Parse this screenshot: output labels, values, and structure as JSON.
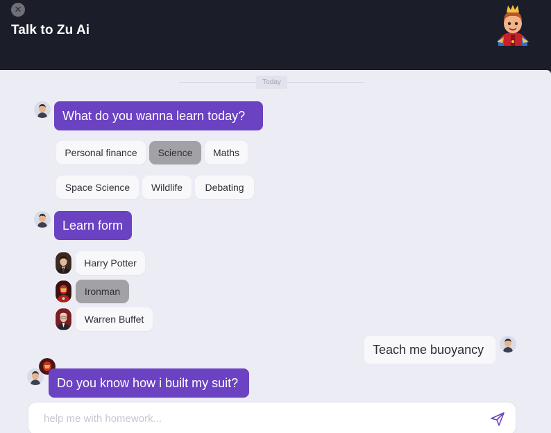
{
  "header": {
    "close_icon": "close-icon",
    "title": "Talk to Zu Ai",
    "avatar_icon": "king-avatar-icon"
  },
  "chat": {
    "date_divider": "Today",
    "messages": [
      {
        "sender": "bot",
        "text": "What do you wanna learn today?"
      },
      {
        "sender": "bot",
        "text": "Learn form"
      },
      {
        "sender": "user",
        "text": "Teach me buoyancy"
      },
      {
        "sender": "bot",
        "text": "Do you know how i built my suit?"
      }
    ],
    "topic_options": [
      {
        "label": "Personal finance",
        "selected": false
      },
      {
        "label": "Science",
        "selected": true
      },
      {
        "label": "Maths",
        "selected": false
      },
      {
        "label": "Space Science",
        "selected": false
      },
      {
        "label": "Wildlife",
        "selected": false
      },
      {
        "label": "Debating",
        "selected": false
      }
    ],
    "mentor_options": [
      {
        "label": "Harry Potter",
        "selected": false,
        "avatar": "harry-potter-avatar"
      },
      {
        "label": "Ironman",
        "selected": true,
        "avatar": "ironman-avatar"
      },
      {
        "label": "Warren Buffet",
        "selected": false,
        "avatar": "warren-buffet-avatar"
      }
    ]
  },
  "composer": {
    "placeholder": "help me with homework...",
    "value": "",
    "send_icon": "send-icon"
  },
  "colors": {
    "header_bg": "#1B1D29",
    "panel_bg": "#ECECF5",
    "bot_bubble": "#6A42C2",
    "selected_chip": "#A2A2A6",
    "chip_bg": "#F8F8FB"
  }
}
